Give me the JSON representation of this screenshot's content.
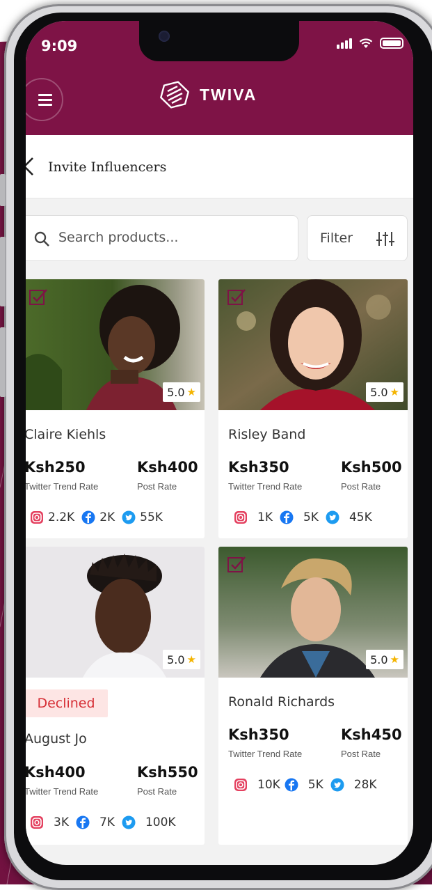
{
  "status_bar": {
    "time": "9:09"
  },
  "header": {
    "brand_name": "TWIVA"
  },
  "page": {
    "title": "Invite Influencers"
  },
  "search": {
    "placeholder": "Search products..."
  },
  "filter": {
    "label": "Filter"
  },
  "influencers": [
    {
      "name": "Claire Kiehls",
      "rating": "5.0",
      "twitter_trend_rate": "Ksh250",
      "twitter_trend_rate_label": "Twitter Trend Rate",
      "post_rate": "Ksh400",
      "post_rate_label": "Post Rate",
      "instagram": "2.2K",
      "facebook": "2K",
      "twitter": "55K"
    },
    {
      "name": "Risley Band",
      "rating": "5.0",
      "twitter_trend_rate": "Ksh350",
      "twitter_trend_rate_label": "Twitter Trend Rate",
      "post_rate": "Ksh500",
      "post_rate_label": "Post Rate",
      "instagram": "1K",
      "facebook": "5K",
      "twitter": "45K"
    },
    {
      "name": "August Jo",
      "rating": "5.0",
      "status": "Declined",
      "twitter_trend_rate": "Ksh400",
      "twitter_trend_rate_label": "Twitter Trend Rate",
      "post_rate": "Ksh550",
      "post_rate_label": "Post Rate",
      "instagram": "3K",
      "facebook": "7K",
      "twitter": "100K"
    },
    {
      "name": "Ronald Richards",
      "rating": "5.0",
      "twitter_trend_rate": "Ksh350",
      "twitter_trend_rate_label": "Twitter Trend Rate",
      "post_rate": "Ksh450",
      "post_rate_label": "Post Rate",
      "instagram": "10K",
      "facebook": "5K",
      "twitter": "28K"
    }
  ],
  "colors": {
    "brand": "#7e1346",
    "declined_text": "#d62f36",
    "declined_bg": "#fde5e4",
    "star": "#f4b400",
    "facebook": "#1877f2",
    "twitter": "#1d9bf0"
  },
  "icons": {
    "menu": "hamburger-icon",
    "brand": "twiva-logo",
    "back": "chevron-left-icon",
    "search": "search-icon",
    "filter": "sliders-icon",
    "select": "checkbox-icon",
    "star": "star-icon",
    "instagram": "instagram-icon",
    "facebook": "facebook-icon",
    "twitter": "twitter-icon"
  }
}
